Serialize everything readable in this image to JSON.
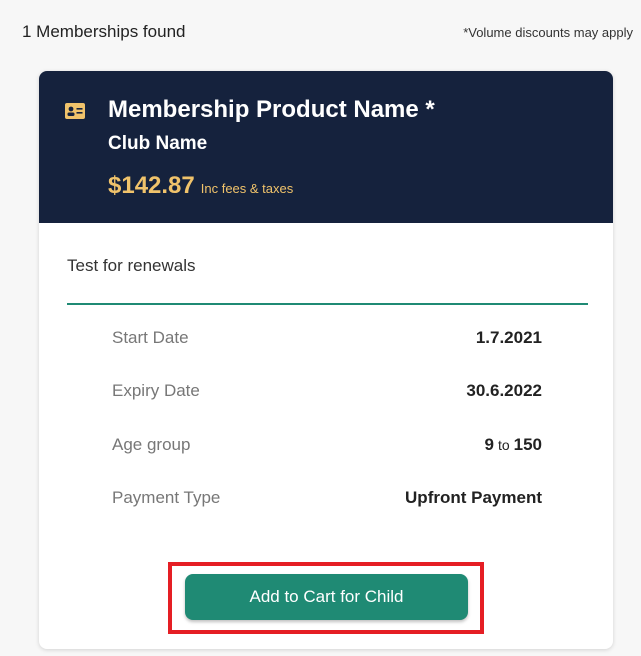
{
  "results": {
    "count_text": "1 Memberships found",
    "volume_note": "*Volume discounts may apply"
  },
  "membership": {
    "icon": "id-card-icon",
    "product_name": "Membership Product Name *",
    "club_name": "Club Name",
    "price": "$142.87",
    "price_suffix": "Inc fees & taxes",
    "description": "Test for renewals",
    "details": {
      "start_label": "Start Date",
      "start_value": "1.7.2021",
      "expiry_label": "Expiry Date",
      "expiry_value": "30.6.2022",
      "age_label": "Age group",
      "age_min": "9",
      "age_to": "to",
      "age_max": "150",
      "payment_label": "Payment Type",
      "payment_value": "Upfront Payment"
    },
    "add_button_label": "Add to Cart for Child"
  },
  "colors": {
    "header_bg": "#15223d",
    "price_gold": "#f0c36b",
    "accent_green": "#1f8a74",
    "highlight_red": "#e51e24"
  }
}
